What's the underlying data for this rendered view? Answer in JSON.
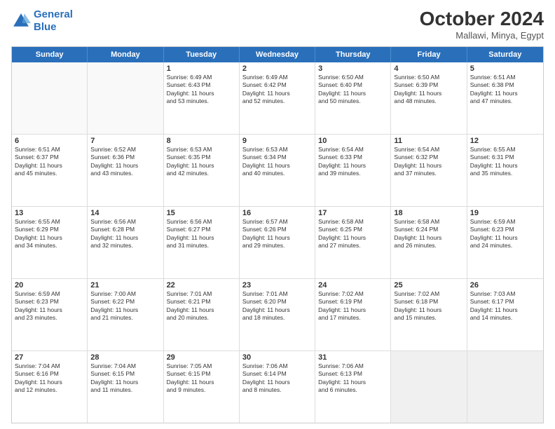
{
  "header": {
    "logo_line1": "General",
    "logo_line2": "Blue",
    "month_title": "October 2024",
    "subtitle": "Mallawi, Minya, Egypt"
  },
  "days_of_week": [
    "Sunday",
    "Monday",
    "Tuesday",
    "Wednesday",
    "Thursday",
    "Friday",
    "Saturday"
  ],
  "rows": [
    [
      {
        "day": "",
        "lines": [],
        "empty": true
      },
      {
        "day": "",
        "lines": [],
        "empty": true
      },
      {
        "day": "1",
        "lines": [
          "Sunrise: 6:49 AM",
          "Sunset: 6:43 PM",
          "Daylight: 11 hours",
          "and 53 minutes."
        ]
      },
      {
        "day": "2",
        "lines": [
          "Sunrise: 6:49 AM",
          "Sunset: 6:42 PM",
          "Daylight: 11 hours",
          "and 52 minutes."
        ]
      },
      {
        "day": "3",
        "lines": [
          "Sunrise: 6:50 AM",
          "Sunset: 6:40 PM",
          "Daylight: 11 hours",
          "and 50 minutes."
        ]
      },
      {
        "day": "4",
        "lines": [
          "Sunrise: 6:50 AM",
          "Sunset: 6:39 PM",
          "Daylight: 11 hours",
          "and 48 minutes."
        ]
      },
      {
        "day": "5",
        "lines": [
          "Sunrise: 6:51 AM",
          "Sunset: 6:38 PM",
          "Daylight: 11 hours",
          "and 47 minutes."
        ]
      }
    ],
    [
      {
        "day": "6",
        "lines": [
          "Sunrise: 6:51 AM",
          "Sunset: 6:37 PM",
          "Daylight: 11 hours",
          "and 45 minutes."
        ]
      },
      {
        "day": "7",
        "lines": [
          "Sunrise: 6:52 AM",
          "Sunset: 6:36 PM",
          "Daylight: 11 hours",
          "and 43 minutes."
        ]
      },
      {
        "day": "8",
        "lines": [
          "Sunrise: 6:53 AM",
          "Sunset: 6:35 PM",
          "Daylight: 11 hours",
          "and 42 minutes."
        ]
      },
      {
        "day": "9",
        "lines": [
          "Sunrise: 6:53 AM",
          "Sunset: 6:34 PM",
          "Daylight: 11 hours",
          "and 40 minutes."
        ]
      },
      {
        "day": "10",
        "lines": [
          "Sunrise: 6:54 AM",
          "Sunset: 6:33 PM",
          "Daylight: 11 hours",
          "and 39 minutes."
        ]
      },
      {
        "day": "11",
        "lines": [
          "Sunrise: 6:54 AM",
          "Sunset: 6:32 PM",
          "Daylight: 11 hours",
          "and 37 minutes."
        ]
      },
      {
        "day": "12",
        "lines": [
          "Sunrise: 6:55 AM",
          "Sunset: 6:31 PM",
          "Daylight: 11 hours",
          "and 35 minutes."
        ]
      }
    ],
    [
      {
        "day": "13",
        "lines": [
          "Sunrise: 6:55 AM",
          "Sunset: 6:29 PM",
          "Daylight: 11 hours",
          "and 34 minutes."
        ]
      },
      {
        "day": "14",
        "lines": [
          "Sunrise: 6:56 AM",
          "Sunset: 6:28 PM",
          "Daylight: 11 hours",
          "and 32 minutes."
        ]
      },
      {
        "day": "15",
        "lines": [
          "Sunrise: 6:56 AM",
          "Sunset: 6:27 PM",
          "Daylight: 11 hours",
          "and 31 minutes."
        ]
      },
      {
        "day": "16",
        "lines": [
          "Sunrise: 6:57 AM",
          "Sunset: 6:26 PM",
          "Daylight: 11 hours",
          "and 29 minutes."
        ]
      },
      {
        "day": "17",
        "lines": [
          "Sunrise: 6:58 AM",
          "Sunset: 6:25 PM",
          "Daylight: 11 hours",
          "and 27 minutes."
        ]
      },
      {
        "day": "18",
        "lines": [
          "Sunrise: 6:58 AM",
          "Sunset: 6:24 PM",
          "Daylight: 11 hours",
          "and 26 minutes."
        ]
      },
      {
        "day": "19",
        "lines": [
          "Sunrise: 6:59 AM",
          "Sunset: 6:23 PM",
          "Daylight: 11 hours",
          "and 24 minutes."
        ]
      }
    ],
    [
      {
        "day": "20",
        "lines": [
          "Sunrise: 6:59 AM",
          "Sunset: 6:23 PM",
          "Daylight: 11 hours",
          "and 23 minutes."
        ]
      },
      {
        "day": "21",
        "lines": [
          "Sunrise: 7:00 AM",
          "Sunset: 6:22 PM",
          "Daylight: 11 hours",
          "and 21 minutes."
        ]
      },
      {
        "day": "22",
        "lines": [
          "Sunrise: 7:01 AM",
          "Sunset: 6:21 PM",
          "Daylight: 11 hours",
          "and 20 minutes."
        ]
      },
      {
        "day": "23",
        "lines": [
          "Sunrise: 7:01 AM",
          "Sunset: 6:20 PM",
          "Daylight: 11 hours",
          "and 18 minutes."
        ]
      },
      {
        "day": "24",
        "lines": [
          "Sunrise: 7:02 AM",
          "Sunset: 6:19 PM",
          "Daylight: 11 hours",
          "and 17 minutes."
        ]
      },
      {
        "day": "25",
        "lines": [
          "Sunrise: 7:02 AM",
          "Sunset: 6:18 PM",
          "Daylight: 11 hours",
          "and 15 minutes."
        ]
      },
      {
        "day": "26",
        "lines": [
          "Sunrise: 7:03 AM",
          "Sunset: 6:17 PM",
          "Daylight: 11 hours",
          "and 14 minutes."
        ]
      }
    ],
    [
      {
        "day": "27",
        "lines": [
          "Sunrise: 7:04 AM",
          "Sunset: 6:16 PM",
          "Daylight: 11 hours",
          "and 12 minutes."
        ]
      },
      {
        "day": "28",
        "lines": [
          "Sunrise: 7:04 AM",
          "Sunset: 6:15 PM",
          "Daylight: 11 hours",
          "and 11 minutes."
        ]
      },
      {
        "day": "29",
        "lines": [
          "Sunrise: 7:05 AM",
          "Sunset: 6:15 PM",
          "Daylight: 11 hours",
          "and 9 minutes."
        ]
      },
      {
        "day": "30",
        "lines": [
          "Sunrise: 7:06 AM",
          "Sunset: 6:14 PM",
          "Daylight: 11 hours",
          "and 8 minutes."
        ]
      },
      {
        "day": "31",
        "lines": [
          "Sunrise: 7:06 AM",
          "Sunset: 6:13 PM",
          "Daylight: 11 hours",
          "and 6 minutes."
        ]
      },
      {
        "day": "",
        "lines": [],
        "empty": true,
        "shaded": true
      },
      {
        "day": "",
        "lines": [],
        "empty": true,
        "shaded": true
      }
    ]
  ]
}
